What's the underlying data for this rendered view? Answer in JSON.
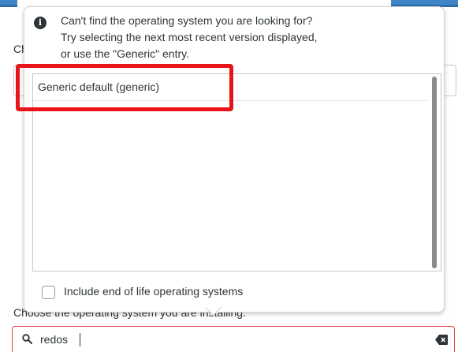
{
  "background": {
    "choose_label_partial": "Ch",
    "bottom_label": "Choose the operating system you are installing:"
  },
  "popover": {
    "info_lines": [
      "Can't find the operating system you are looking for?",
      "Try selecting the next most recent version displayed,",
      "or use the \"Generic\" entry."
    ],
    "list_items": [
      "Generic default (generic)"
    ],
    "eol_checkbox": {
      "label": "Include end of life operating systems",
      "checked": false
    }
  },
  "search": {
    "value": "redos",
    "icon": "search-icon",
    "clear_icon": "clear-backspace-icon"
  },
  "colors": {
    "accent_blue": "#3e86c7",
    "highlight_red": "#e8141a",
    "error_border": "#dd4444"
  }
}
